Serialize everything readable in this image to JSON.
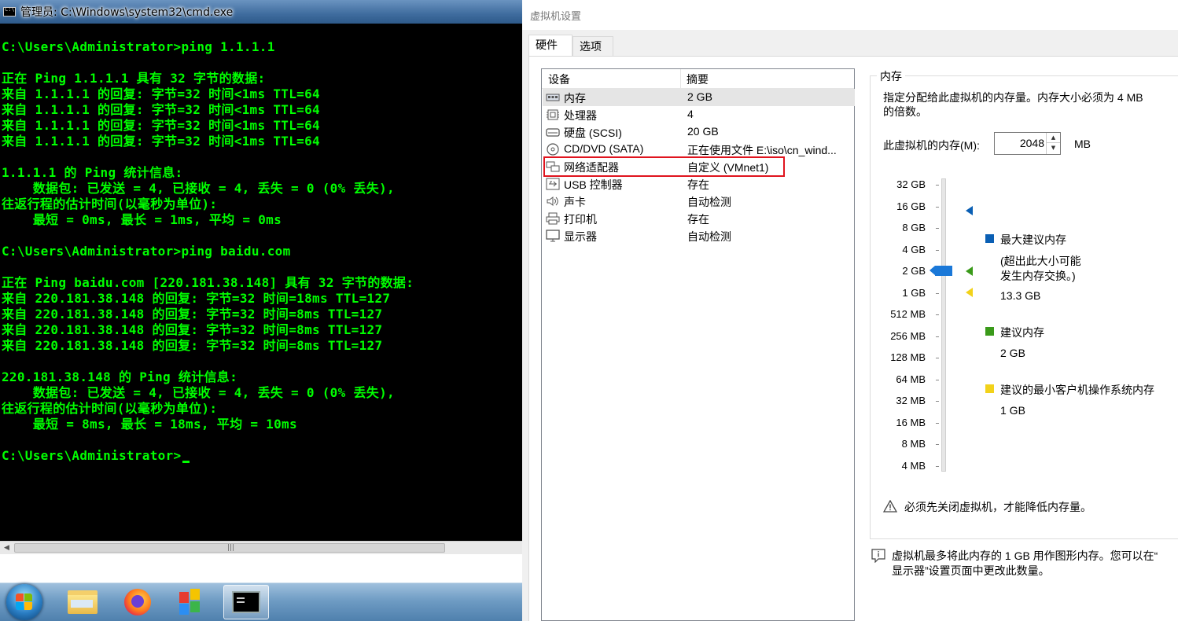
{
  "cmd": {
    "title": "管理员: C:\\Windows\\system32\\cmd.exe",
    "lines": [
      "C:\\Users\\Administrator>ping 1.1.1.1",
      "",
      "正在 Ping 1.1.1.1 具有 32 字节的数据:",
      "来自 1.1.1.1 的回复: 字节=32 时间<1ms TTL=64",
      "来自 1.1.1.1 的回复: 字节=32 时间<1ms TTL=64",
      "来自 1.1.1.1 的回复: 字节=32 时间<1ms TTL=64",
      "来自 1.1.1.1 的回复: 字节=32 时间<1ms TTL=64",
      "",
      "1.1.1.1 的 Ping 统计信息:",
      "    数据包: 已发送 = 4, 已接收 = 4, 丢失 = 0 (0% 丢失),",
      "往返行程的估计时间(以毫秒为单位):",
      "    最短 = 0ms, 最长 = 1ms, 平均 = 0ms",
      "",
      "C:\\Users\\Administrator>ping baidu.com",
      "",
      "正在 Ping baidu.com [220.181.38.148] 具有 32 字节的数据:",
      "来自 220.181.38.148 的回复: 字节=32 时间=18ms TTL=127",
      "来自 220.181.38.148 的回复: 字节=32 时间=8ms TTL=127",
      "来自 220.181.38.148 的回复: 字节=32 时间=8ms TTL=127",
      "来自 220.181.38.148 的回复: 字节=32 时间=8ms TTL=127",
      "",
      "220.181.38.148 的 Ping 统计信息:",
      "    数据包: 已发送 = 4, 已接收 = 4, 丢失 = 0 (0% 丢失),",
      "往返行程的估计时间(以毫秒为单位):",
      "    最短 = 8ms, 最长 = 18ms, 平均 = 10ms",
      "",
      "C:\\Users\\Administrator>"
    ],
    "text_color": "#00ff00",
    "scroll_grip": "|||"
  },
  "taskbar": {
    "items": [
      "start-button",
      "file-explorer-icon",
      "firefox-icon",
      "app-tiles-icon",
      "cmd-window-icon"
    ]
  },
  "dialog": {
    "title": "虚拟机设置",
    "tabs": [
      "硬件",
      "选项"
    ],
    "device_list": {
      "headers": {
        "device": "设备",
        "summary": "摘要"
      },
      "rows": [
        {
          "icon": "memory-icon",
          "name": "内存",
          "summary": "2 GB"
        },
        {
          "icon": "processor-icon",
          "name": "处理器",
          "summary": "4"
        },
        {
          "icon": "hard-disk-icon",
          "name": "硬盘 (SCSI)",
          "summary": "20 GB"
        },
        {
          "icon": "cd-dvd-icon",
          "name": "CD/DVD (SATA)",
          "summary": "正在使用文件 E:\\iso\\cn_wind..."
        },
        {
          "icon": "network-adapter-icon",
          "name": "网络适配器",
          "summary": "自定义 (VMnet1)"
        },
        {
          "icon": "usb-icon",
          "name": "USB 控制器",
          "summary": "存在"
        },
        {
          "icon": "sound-card-icon",
          "name": "声卡",
          "summary": "自动检测"
        },
        {
          "icon": "printer-icon",
          "name": "打印机",
          "summary": "存在"
        },
        {
          "icon": "display-icon",
          "name": "显示器",
          "summary": "自动检测"
        }
      ]
    },
    "memory": {
      "group_title": "内存",
      "description_line1": "指定分配给此虚拟机的内存量。内存大小必须为 4 MB",
      "description_line2": "的倍数。",
      "input_label": "此虚拟机的内存(M):",
      "input_value": "2048",
      "unit": "MB",
      "scale_labels": [
        "32 GB",
        "16 GB",
        "8 GB",
        "4 GB",
        "2 GB",
        "1 GB",
        "512 MB",
        "256 MB",
        "128 MB",
        "64 MB",
        "32 MB",
        "16 MB",
        "8 MB",
        "4 MB"
      ],
      "slider_value": "2 GB",
      "legend": {
        "max_title": "最大建议内存",
        "max_note_line1": "(超出此大小可能",
        "max_note_line2": "发生内存交换。)",
        "max_value": "13.3 GB",
        "max_color": "#0a5fb4",
        "recommended_title": "建议内存",
        "recommended_value": "2 GB",
        "recommended_color": "#3a9a1a",
        "min_title": "建议的最小客户机操作系统内存",
        "min_value": "1 GB",
        "min_color": "#f2d21a"
      },
      "warning": "必须先关闭虚拟机，才能降低内存量。",
      "info_line1": "虚拟机最多将此内存的 1 GB 用作图形内存。您可以在“",
      "info_line2": "显示器”设置页面中更改此数量。"
    },
    "highlight_color": "#e0141e"
  }
}
